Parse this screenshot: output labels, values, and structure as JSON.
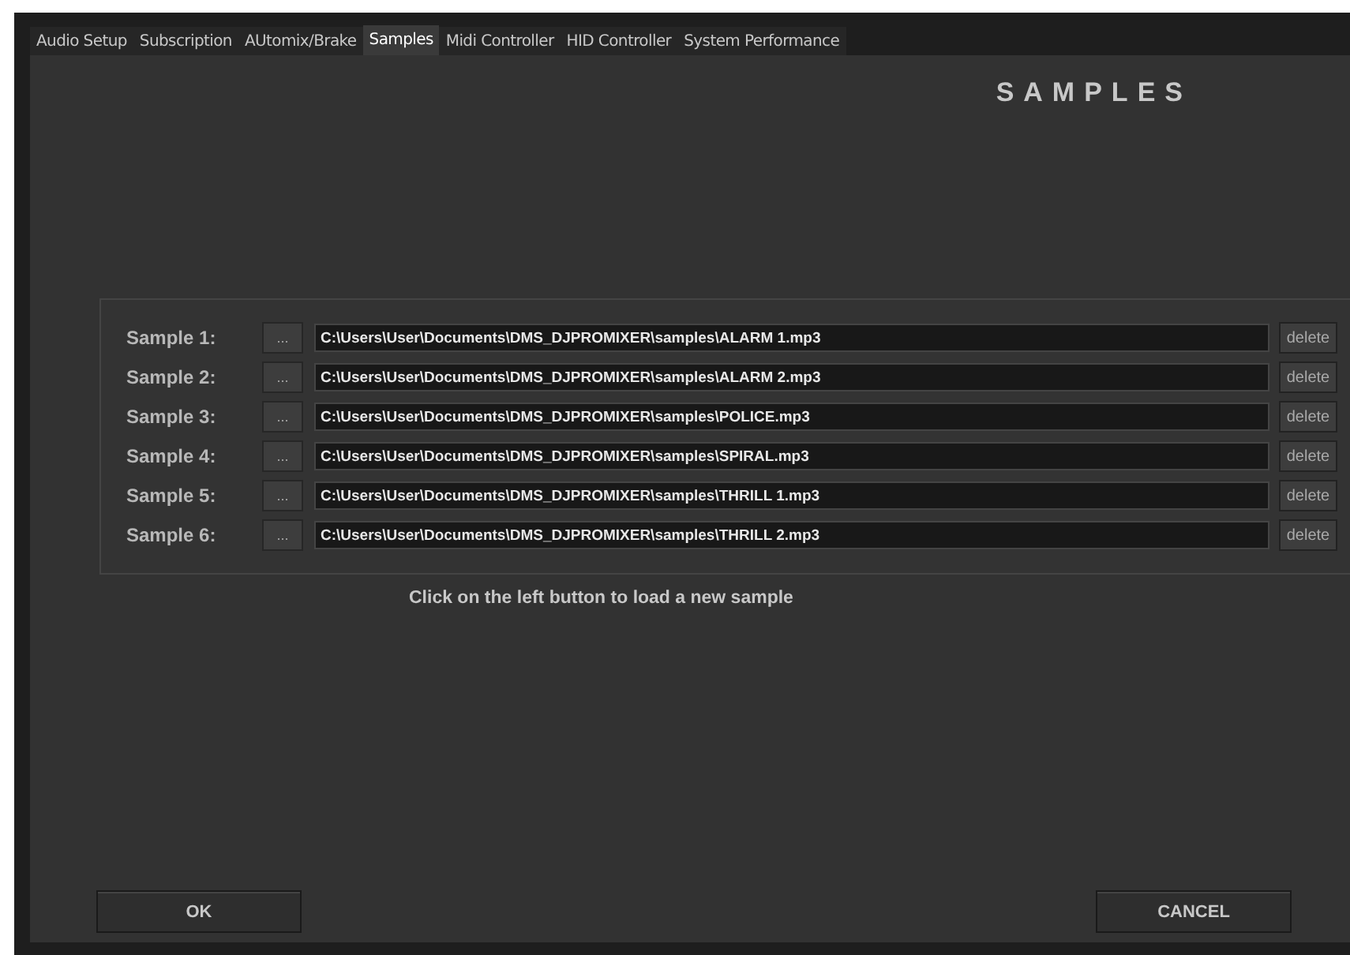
{
  "tabs": [
    {
      "label": "Audio Setup",
      "selected": false
    },
    {
      "label": "Subscription",
      "selected": false
    },
    {
      "label": "AUtomix/Brake",
      "selected": false
    },
    {
      "label": "Samples",
      "selected": true
    },
    {
      "label": "Midi Controller",
      "selected": false
    },
    {
      "label": "HID Controller",
      "selected": false
    },
    {
      "label": "System Performance",
      "selected": false
    }
  ],
  "title": "SAMPLES",
  "samples": [
    {
      "label": "Sample 1:",
      "browse": "...",
      "path": "C:\\Users\\User\\Documents\\DMS_DJPROMIXER\\samples\\ALARM 1.mp3",
      "delete": "delete"
    },
    {
      "label": "Sample 2:",
      "browse": "...",
      "path": "C:\\Users\\User\\Documents\\DMS_DJPROMIXER\\samples\\ALARM 2.mp3",
      "delete": "delete"
    },
    {
      "label": "Sample 3:",
      "browse": "...",
      "path": "C:\\Users\\User\\Documents\\DMS_DJPROMIXER\\samples\\POLICE.mp3",
      "delete": "delete"
    },
    {
      "label": "Sample 4:",
      "browse": "...",
      "path": "C:\\Users\\User\\Documents\\DMS_DJPROMIXER\\samples\\SPIRAL.mp3",
      "delete": "delete"
    },
    {
      "label": "Sample 5:",
      "browse": "...",
      "path": "C:\\Users\\User\\Documents\\DMS_DJPROMIXER\\samples\\THRILL 1.mp3",
      "delete": "delete"
    },
    {
      "label": "Sample 6:",
      "browse": "...",
      "path": "C:\\Users\\User\\Documents\\DMS_DJPROMIXER\\samples\\THRILL 2.mp3",
      "delete": "delete"
    }
  ],
  "hint": "Click on the left button to load a new sample",
  "buttons": {
    "ok": "OK",
    "cancel": "CANCEL"
  }
}
